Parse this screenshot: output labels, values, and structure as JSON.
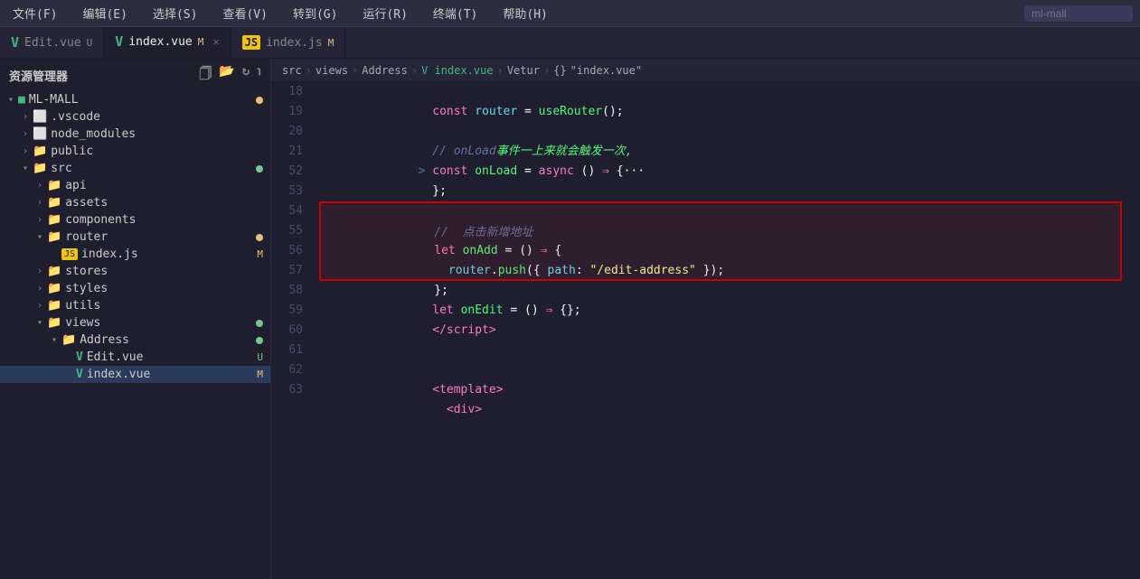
{
  "menuBar": {
    "items": [
      "文件(F)",
      "编辑(E)",
      "选择(S)",
      "查看(V)",
      "转到(G)",
      "运行(R)",
      "终端(T)",
      "帮助(H)"
    ],
    "searchPlaceholder": "ml-mall"
  },
  "tabs": [
    {
      "id": "edit-vue",
      "icon": "vue",
      "label": "Edit.vue",
      "badge": "U",
      "active": false,
      "closable": false
    },
    {
      "id": "index-vue",
      "icon": "vue",
      "label": "index.vue",
      "badge": "M",
      "active": true,
      "closable": true
    },
    {
      "id": "index-js",
      "icon": "js",
      "label": "index.js",
      "badge": "M",
      "active": false,
      "closable": false
    }
  ],
  "breadcrumb": {
    "parts": [
      "src",
      ">",
      "views",
      ">",
      "Address",
      ">",
      "index.vue",
      ">",
      "Vetur",
      ">",
      "{}",
      "\"index.vue\""
    ]
  },
  "sidebar": {
    "title": "资源管理器",
    "rootLabel": "ML-MALL",
    "items": [
      {
        "type": "folder",
        "label": ".vscode",
        "indent": 1,
        "expanded": false,
        "icon": "vscode",
        "badge": ""
      },
      {
        "type": "folder",
        "label": "node_modules",
        "indent": 1,
        "expanded": false,
        "icon": "node",
        "badge": ""
      },
      {
        "type": "folder",
        "label": "public",
        "indent": 1,
        "expanded": false,
        "icon": "folder",
        "badge": ""
      },
      {
        "type": "folder",
        "label": "src",
        "indent": 1,
        "expanded": true,
        "icon": "folder",
        "badge": "dot-green"
      },
      {
        "type": "folder",
        "label": "api",
        "indent": 2,
        "expanded": false,
        "icon": "folder",
        "badge": ""
      },
      {
        "type": "folder",
        "label": "assets",
        "indent": 2,
        "expanded": false,
        "icon": "folder",
        "badge": ""
      },
      {
        "type": "folder",
        "label": "components",
        "indent": 2,
        "expanded": false,
        "icon": "folder",
        "badge": ""
      },
      {
        "type": "folder",
        "label": "router",
        "indent": 2,
        "expanded": true,
        "icon": "folder",
        "badge": "dot-amber"
      },
      {
        "type": "file",
        "label": "index.js",
        "indent": 3,
        "icon": "js",
        "badge": "M"
      },
      {
        "type": "folder",
        "label": "stores",
        "indent": 2,
        "expanded": false,
        "icon": "folder",
        "badge": ""
      },
      {
        "type": "folder",
        "label": "styles",
        "indent": 2,
        "expanded": false,
        "icon": "folder",
        "badge": ""
      },
      {
        "type": "folder",
        "label": "utils",
        "indent": 2,
        "expanded": false,
        "icon": "folder",
        "badge": ""
      },
      {
        "type": "folder",
        "label": "views",
        "indent": 2,
        "expanded": true,
        "icon": "folder",
        "badge": "dot-green"
      },
      {
        "type": "folder",
        "label": "Address",
        "indent": 3,
        "expanded": true,
        "icon": "folder",
        "badge": "dot-green"
      },
      {
        "type": "file",
        "label": "Edit.vue",
        "indent": 4,
        "icon": "vue",
        "badge": "U"
      },
      {
        "type": "file",
        "label": "index.vue",
        "indent": 4,
        "icon": "vue",
        "badge": "M",
        "selected": true
      }
    ]
  },
  "editor": {
    "lines": [
      {
        "num": 18,
        "tokens": [
          {
            "t": "      ",
            "c": ""
          },
          {
            "t": "const ",
            "c": "kw"
          },
          {
            "t": "router",
            "c": "router-color"
          },
          {
            "t": " = ",
            "c": "punct"
          },
          {
            "t": "useRouter",
            "c": "fn"
          },
          {
            "t": "();",
            "c": "punct"
          }
        ]
      },
      {
        "num": 19,
        "tokens": []
      },
      {
        "num": 20,
        "tokens": [
          {
            "t": "      ",
            "c": ""
          },
          {
            "t": "// onLoad",
            "c": "cm"
          },
          {
            "t": "事件一上来就会触发一次,",
            "c": "cm-cn"
          }
        ]
      },
      {
        "num": 21,
        "tokens": [
          {
            "t": "    > ",
            "c": "collapsed-line"
          },
          {
            "t": "const ",
            "c": "kw"
          },
          {
            "t": "onLoad",
            "c": "fn"
          },
          {
            "t": " = ",
            "c": "punct"
          },
          {
            "t": "async ",
            "c": "kw"
          },
          {
            "t": "() ",
            "c": "punct"
          },
          {
            "t": "⇒",
            "c": "arrow"
          },
          {
            "t": " {···",
            "c": "punct"
          }
        ]
      },
      {
        "num": 52,
        "tokens": [
          {
            "t": "      ",
            "c": ""
          },
          {
            "t": "};",
            "c": "punct"
          }
        ]
      },
      {
        "num": 53,
        "tokens": []
      },
      {
        "num": 54,
        "tokens": [
          {
            "t": "      ",
            "c": ""
          },
          {
            "t": "//  点击新增地址",
            "c": "cm"
          }
        ],
        "highlight": "top"
      },
      {
        "num": 55,
        "tokens": [
          {
            "t": "      ",
            "c": ""
          },
          {
            "t": "let ",
            "c": "kw"
          },
          {
            "t": "onAdd",
            "c": "fn"
          },
          {
            "t": " = ",
            "c": "punct"
          },
          {
            "t": "() ",
            "c": "punct"
          },
          {
            "t": "⇒",
            "c": "arrow"
          },
          {
            "t": " {",
            "c": "punct"
          }
        ],
        "highlight": "mid"
      },
      {
        "num": 56,
        "tokens": [
          {
            "t": "        ",
            "c": ""
          },
          {
            "t": "router",
            "c": "router-color"
          },
          {
            "t": ".",
            "c": "punct"
          },
          {
            "t": "push",
            "c": "fn"
          },
          {
            "t": "({ ",
            "c": "punct"
          },
          {
            "t": "path",
            "c": "prop"
          },
          {
            "t": ": ",
            "c": "punct"
          },
          {
            "t": "\"/edit-address\"",
            "c": "str"
          },
          {
            "t": " });",
            "c": "punct"
          }
        ],
        "highlight": "mid"
      },
      {
        "num": 57,
        "tokens": [
          {
            "t": "      ",
            "c": ""
          },
          {
            "t": "};",
            "c": "punct"
          }
        ],
        "highlight": "bot"
      },
      {
        "num": 58,
        "tokens": [
          {
            "t": "      ",
            "c": ""
          },
          {
            "t": "let ",
            "c": "kw"
          },
          {
            "t": "onEdit",
            "c": "fn"
          },
          {
            "t": " = ",
            "c": "punct"
          },
          {
            "t": "() ",
            "c": "punct"
          },
          {
            "t": "⇒",
            "c": "arrow"
          },
          {
            "t": " {};",
            "c": "punct"
          }
        ]
      },
      {
        "num": 59,
        "tokens": [
          {
            "t": "      ",
            "c": ""
          },
          {
            "t": "</",
            "c": "tag"
          },
          {
            "t": "script",
            "c": "tag"
          },
          {
            "t": ">",
            "c": "tag"
          }
        ]
      },
      {
        "num": 60,
        "tokens": []
      },
      {
        "num": 61,
        "tokens": []
      },
      {
        "num": 62,
        "tokens": [
          {
            "t": "      ",
            "c": ""
          },
          {
            "t": "<",
            "c": "tag"
          },
          {
            "t": "template",
            "c": "tag"
          },
          {
            "t": ">",
            "c": "tag"
          }
        ]
      },
      {
        "num": 63,
        "tokens": [
          {
            "t": "        ",
            "c": ""
          },
          {
            "t": "<",
            "c": "tag"
          },
          {
            "t": "div",
            "c": "tag"
          },
          {
            "t": ">",
            "c": "tag"
          }
        ]
      }
    ]
  },
  "colors": {
    "bg": "#1e1e2e",
    "sidebar_bg": "#1e1e2e",
    "tab_active": "#1e1e2e",
    "tab_inactive": "#252537",
    "accent": "#42b883",
    "highlight_border": "#cc0000"
  }
}
